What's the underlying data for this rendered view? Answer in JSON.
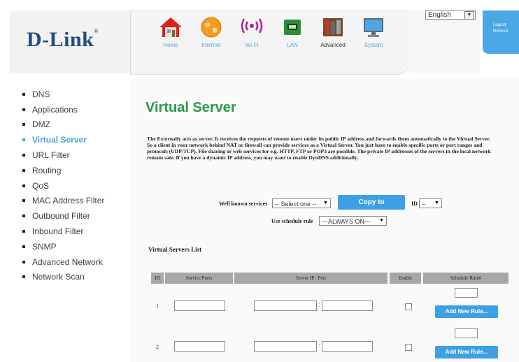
{
  "brand": {
    "logo_text": "D-Link",
    "logo_mark": "®"
  },
  "nav": [
    {
      "label": "Home",
      "icon": "home-icon"
    },
    {
      "label": "Internet",
      "icon": "globe-icon"
    },
    {
      "label": "Wi-Fi",
      "icon": "wifi-icon"
    },
    {
      "label": "LAN",
      "icon": "lan-icon"
    },
    {
      "label": "Advanced",
      "icon": "advanced-settings-icon"
    },
    {
      "label": "System",
      "icon": "computer-icon"
    }
  ],
  "language": {
    "selected": "English"
  },
  "top_right": {
    "logout": "Logout",
    "refresh": "Refresh"
  },
  "sidebar": {
    "items": [
      {
        "label": "DNS"
      },
      {
        "label": "Applications"
      },
      {
        "label": "DMZ"
      },
      {
        "label": "Virtual Server"
      },
      {
        "label": "URL Filter"
      },
      {
        "label": "Routing"
      },
      {
        "label": "QoS"
      },
      {
        "label": "MAC Address Filter"
      },
      {
        "label": "Outbound Filter"
      },
      {
        "label": "Inbound Filter"
      },
      {
        "label": "SNMP"
      },
      {
        "label": "Advanced Network"
      },
      {
        "label": "Network Scan"
      }
    ],
    "active_index": 3
  },
  "page": {
    "title": "Virtual Server",
    "description": "The Externally acts as server. It receives the requests of remote users under its public IP address and forwards them automatically to the Virtual Server. So a client in your network behind NAT or firewall can provide services as a Virtual Server. You just have to enable specific ports or port ranges and protocols (UDP/TCP). File sharing or web services for e.g. HTTP, FTP or POP3 are possible. The private IP addresses of the servers in the local network remain safe. If you have a dynamic IP address, you may want to enable DynDNS additionally."
  },
  "form": {
    "well_known_label": "Well known services",
    "well_known_value": "-- Select one --",
    "copy_label": "Copy to",
    "id_label": "ID",
    "id_value": "--",
    "schedule_label": "Use schedule rule",
    "schedule_value": "---ALWAYS ON---"
  },
  "list": {
    "title": "Virtual Servers List",
    "columns": [
      "ID",
      "Service Ports",
      "Server IP : Port",
      "Enable",
      "Schedule Rule#"
    ],
    "rows": [
      {
        "id": "1",
        "add_label": "Add New Rule..."
      },
      {
        "id": "2",
        "add_label": "Add New Rule..."
      }
    ]
  },
  "colors": {
    "accent": "#3ea0e4",
    "title_green": "#2a9b48",
    "brand": "#1f4f80"
  }
}
